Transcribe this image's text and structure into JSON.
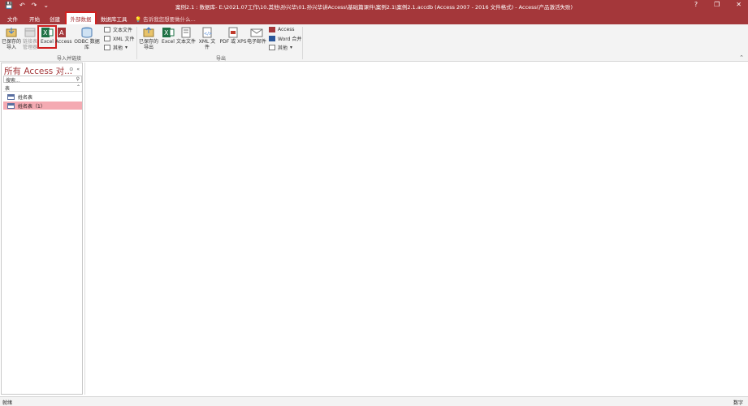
{
  "window": {
    "title": "案例2.1 : 数据库- E:\\2021.07工作\\10.其他\\孙兴华\\01.孙兴华讲Access\\基础篇课件\\案例2.1\\案例2.1.accdb (Access 2007 - 2016 文件格式) - Access(产品激活失败)",
    "help": "?",
    "restore": "❐",
    "close": "✕"
  },
  "qat": {
    "save": "💾",
    "undo": "↶",
    "redo": "↷",
    "more": "⌄"
  },
  "tabs": {
    "file": "文件",
    "home": "开始",
    "create": "创建",
    "external": "外部数据",
    "dbtools": "数据库工具",
    "tellme": "告诉我您想要做什么..."
  },
  "ribbon": {
    "import_group": {
      "label": "导入并链接",
      "saved_imports": "已保存的导入",
      "linked_table_manager": "链接表管理器",
      "excel": "Excel",
      "access": "Access",
      "odbc": "ODBC 数据库",
      "text_file": "文本文件",
      "xml_file": "XML 文件",
      "more": "其他"
    },
    "export_group": {
      "label": "导出",
      "saved_exports": "已保存的导出",
      "excel": "Excel",
      "text_file": "文本文件",
      "xml_file": "XML 文件",
      "pdf_xps": "PDF 或 XPS",
      "email": "电子邮件",
      "access": "Access",
      "word_merge": "Word 合并",
      "more": "其他"
    },
    "collapse": "⌃"
  },
  "nav": {
    "title": "所有 Access 对...",
    "search_placeholder": "搜索...",
    "section": "表",
    "items": [
      {
        "label": "姓名表"
      },
      {
        "label": "姓名表（1）"
      }
    ]
  },
  "status": {
    "left": "就绪",
    "right": "数字"
  },
  "colors": {
    "accent": "#a4373a",
    "highlight": "#d02020",
    "selected_item": "#f4aab2"
  }
}
